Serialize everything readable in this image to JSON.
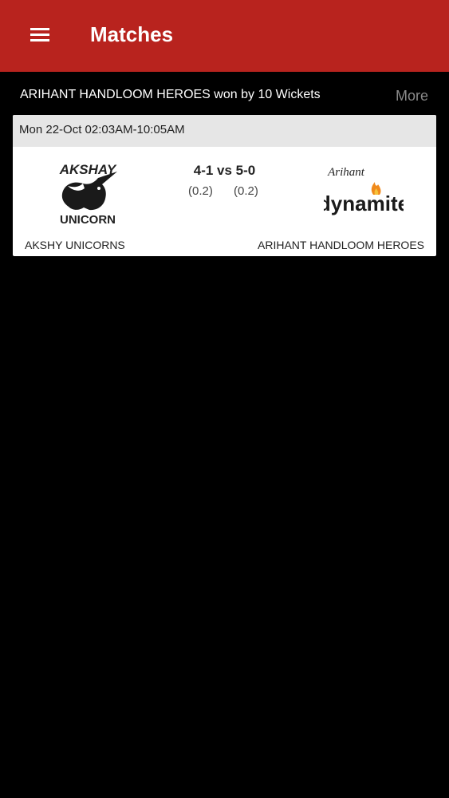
{
  "app_bar": {
    "title": "Matches",
    "background": "#b8231e",
    "menu_icon": "hamburger-menu-icon"
  },
  "match": {
    "result": "ARIHANT HANDLOOM HEROES won by 10 Wickets",
    "more_label": "More",
    "datetime": "Mon 22-Oct 02:03AM-10:05AM",
    "score": "4-1 vs 5-0",
    "home_overs": "(0.2)",
    "away_overs": "(0.2)",
    "home_team": {
      "name": "AKSHY UNICORNS",
      "logo_text_top": "AKSHAY",
      "logo_text_bottom": "UNICORN"
    },
    "away_team": {
      "name": "ARIHANT HANDLOOM HEROES",
      "logo_text_top": "Arihant",
      "logo_text_bottom": "dynamite"
    }
  }
}
